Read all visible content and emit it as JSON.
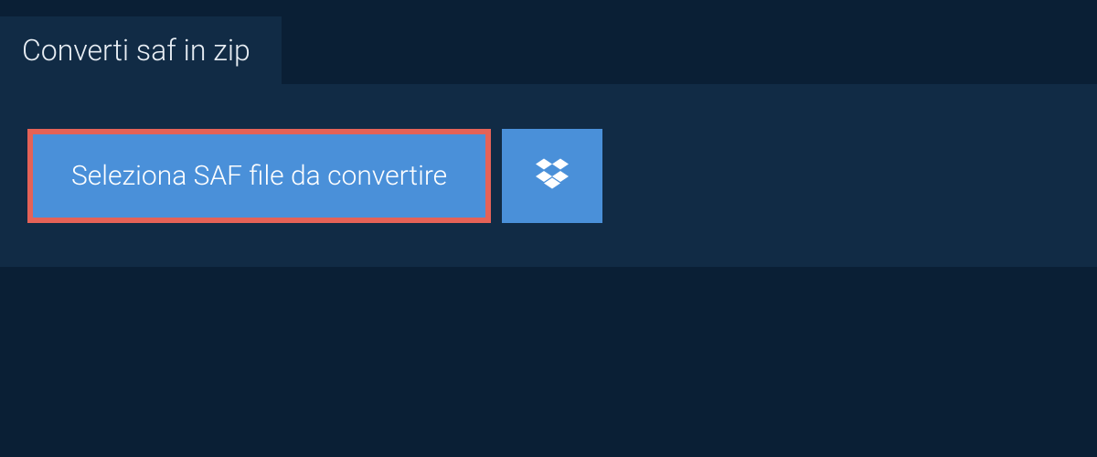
{
  "tab": {
    "title": "Converti saf in zip"
  },
  "actions": {
    "select_file_label": "Seleziona SAF file da convertire"
  }
}
